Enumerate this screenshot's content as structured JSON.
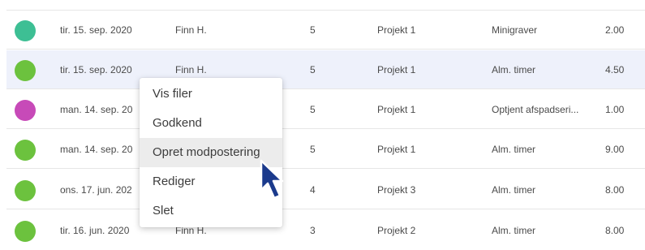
{
  "colors": {
    "teal": "#3dbf94",
    "green": "#6cc23e",
    "magenta": "#c74ab8",
    "selected_row": "#eef1fb",
    "cursor": "#1b3a8c"
  },
  "rows": [
    {
      "status_color": "#3dbf94",
      "date": "tir. 15. sep. 2020",
      "name": "Finn H.",
      "num": "5",
      "project": "Projekt 1",
      "type": "Minigraver",
      "hours": "2.00"
    },
    {
      "status_color": "#6cc23e",
      "date": "tir. 15. sep. 2020",
      "name": "Finn H.",
      "num": "5",
      "project": "Projekt 1",
      "type": "Alm. timer",
      "hours": "4.50",
      "selected": true
    },
    {
      "status_color": "#c74ab8",
      "date": "man. 14. sep. 20",
      "name": "",
      "num": "5",
      "project": "Projekt 1",
      "type": "Optjent afspadseri...",
      "hours": "1.00"
    },
    {
      "status_color": "#6cc23e",
      "date": "man. 14. sep. 20",
      "name": "",
      "num": "5",
      "project": "Projekt 1",
      "type": "Alm. timer",
      "hours": "9.00"
    },
    {
      "status_color": "#6cc23e",
      "date": "ons. 17. jun. 202",
      "name": "",
      "num": "4",
      "project": "Projekt 3",
      "type": "Alm. timer",
      "hours": "8.00"
    },
    {
      "status_color": "#6cc23e",
      "date": "tir. 16. jun. 2020",
      "name": "Finn H.",
      "num": "3",
      "project": "Projekt 2",
      "type": "Alm. timer",
      "hours": "8.00"
    }
  ],
  "context_menu": {
    "items": [
      "Vis filer",
      "Godkend",
      "Opret modpostering",
      "Rediger",
      "Slet"
    ],
    "hovered_index": 2
  },
  "cursor_icon": "arrow-cursor-icon"
}
